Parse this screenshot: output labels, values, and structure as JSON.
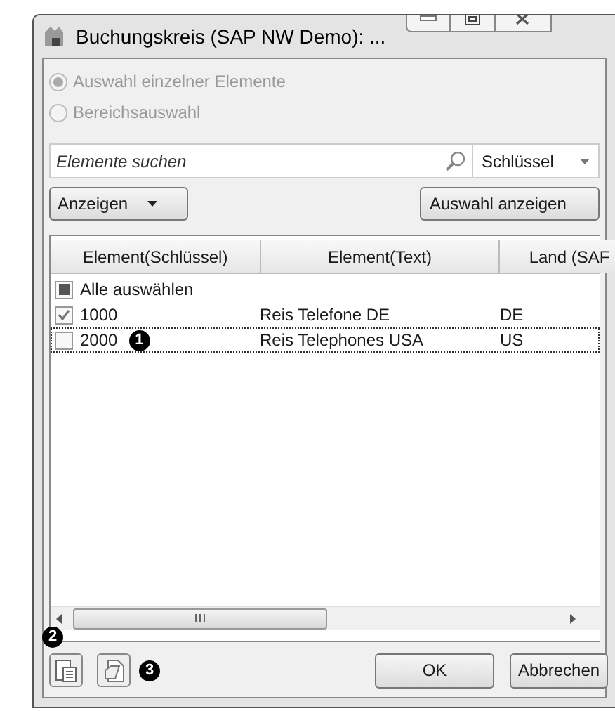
{
  "window": {
    "title": "Buchungskreis (SAP NW Demo): ..."
  },
  "selection_mode": [
    {
      "label": "Auswahl einzelner Elemente",
      "selected": true
    },
    {
      "label": "Bereichsauswahl",
      "selected": false
    }
  ],
  "search": {
    "placeholder": "Elemente suchen",
    "field": "Schlüssel"
  },
  "toolbar": {
    "display_button": "Anzeigen",
    "show_selection_button": "Auswahl anzeigen"
  },
  "table": {
    "columns": [
      "Element(Schlüssel)",
      "Element(Text)",
      "Land (SAF"
    ],
    "select_all": {
      "label": "Alle auswählen",
      "indeterminate": true
    },
    "rows": [
      {
        "cells": [
          "1000",
          "Reis Telefone DE",
          "DE"
        ],
        "checked": true,
        "focused": false
      },
      {
        "cells": [
          "2000",
          "Reis Telephones USA",
          "US"
        ],
        "checked": false,
        "focused": true
      }
    ]
  },
  "callouts": [
    "1",
    "2",
    "3"
  ],
  "buttons": [
    "OK",
    "Abbrechen"
  ]
}
